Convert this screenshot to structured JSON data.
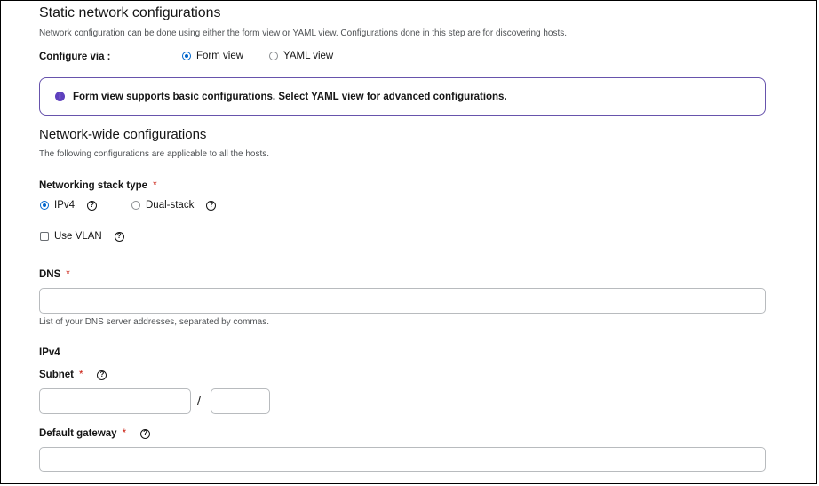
{
  "static": {
    "title": "Static network configurations",
    "description": "Network configuration can be done using either the form view or YAML view. Configurations done in this step are for discovering hosts.",
    "configure_via_label": "Configure via :",
    "form_view_label": "Form view",
    "yaml_view_label": "YAML view",
    "form_view_checked": true
  },
  "alert": {
    "icon": "info-icon",
    "text": "Form view supports basic configurations. Select YAML view for advanced configurations."
  },
  "network_wide": {
    "title": "Network-wide configurations",
    "description": "The following configurations are applicable to all the hosts.",
    "stack_label": "Networking stack type",
    "required_marker": "*",
    "ipv4_label": "IPv4",
    "dual_stack_label": "Dual-stack",
    "ipv4_checked": true,
    "vlan_label": "Use VLAN",
    "vlan_checked": false
  },
  "dns": {
    "label": "DNS",
    "required_marker": "*",
    "value": "",
    "helper": "List of your DNS server addresses, separated by commas."
  },
  "ipv4": {
    "section_label": "IPv4",
    "subnet_label": "Subnet",
    "required_marker": "*",
    "subnet_value": "",
    "prefix_value": "",
    "separator": "/",
    "gateway_label": "Default gateway",
    "gateway_value": ""
  },
  "help_icon_glyph": "?",
  "info_icon_glyph": "i",
  "colors": {
    "accent": "#0066cc",
    "alert_border": "#6753ac",
    "info_icon": "#5e40be",
    "required": "#c9190b"
  }
}
